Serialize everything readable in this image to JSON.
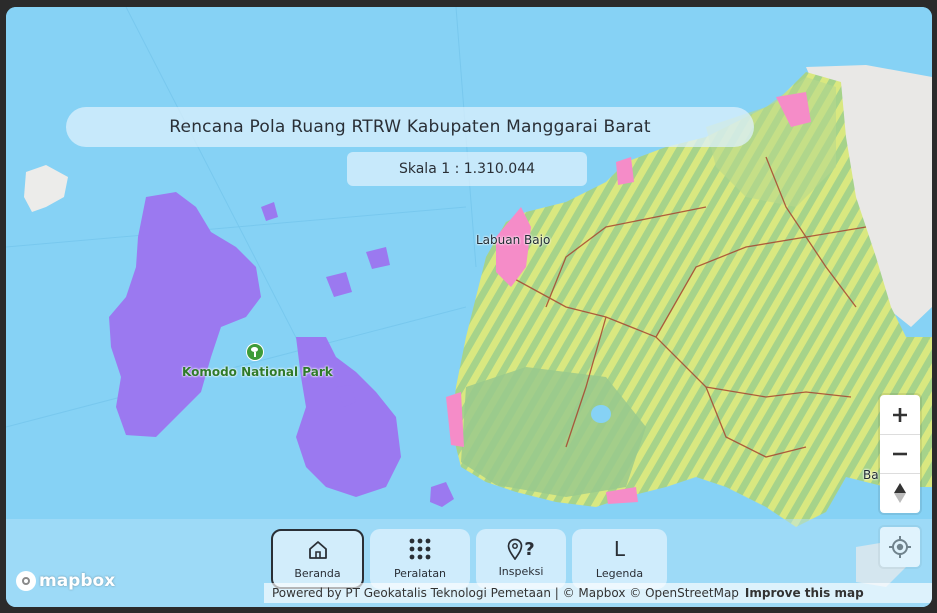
{
  "map": {
    "title": "Rencana Pola Ruang RTRW Kabupaten Manggarai Barat",
    "scale": "Skala 1 : 1.310.044",
    "places": {
      "town": "Labuan Bajo",
      "park": "Komodo National Park",
      "edge_label": "Ba"
    }
  },
  "controls": {
    "zoom_in": "+",
    "zoom_out": "−"
  },
  "toolbar": {
    "home_label": "Beranda",
    "tools_label": "Peralatan",
    "inspect_label": "Inspeksi",
    "legend_label": "Legenda",
    "legend_glyph": "L",
    "inspect_glyph": "?"
  },
  "attribution": {
    "text": "Powered by PT Geokatalis Teknologi Pemetaan | © Mapbox © OpenStreetMap",
    "improve": "Improve this map"
  },
  "logo": "mapbox",
  "colors": {
    "sea": "#86d2f5",
    "protected_area": "#9b79f0",
    "land_green": "#9bcc7f",
    "land_yellow": "#eef07a",
    "settlement": "#f58cc8",
    "boundary": "#a8452f"
  },
  "icons": [
    "home-icon",
    "grid-icon",
    "location-question-icon",
    "plus-icon",
    "minus-icon",
    "compass-icon",
    "geolocate-icon",
    "park-icon",
    "mapbox-logo"
  ]
}
